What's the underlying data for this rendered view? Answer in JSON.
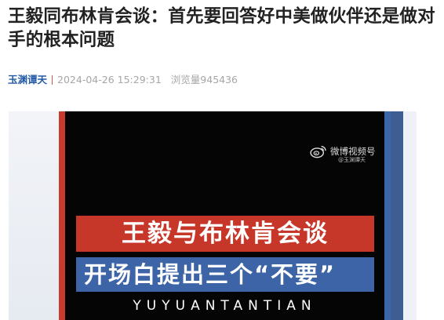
{
  "article": {
    "title": "王毅同布林肯会谈：首先要回答好中美做伙伴还是做对手的根本问题",
    "source": "玉渊谭天",
    "timestamp": "2024-04-26 15:29:31",
    "views_label": "浏览量",
    "views": "945436"
  },
  "video": {
    "watermark_text": "微博视频号",
    "watermark_sub": "@玉渊谭天",
    "watermark_icon": "weibo-logo-icon",
    "headline": "王毅与布林肯会谈",
    "subheadline": "开场白提出三个“不要”",
    "pinyin": "YUYUANTANTIAN"
  },
  "colors": {
    "source_link": "#245ba7",
    "separator": "#d9534f",
    "banner_red": "#c6372a",
    "banner_blue": "#3c64a6"
  }
}
